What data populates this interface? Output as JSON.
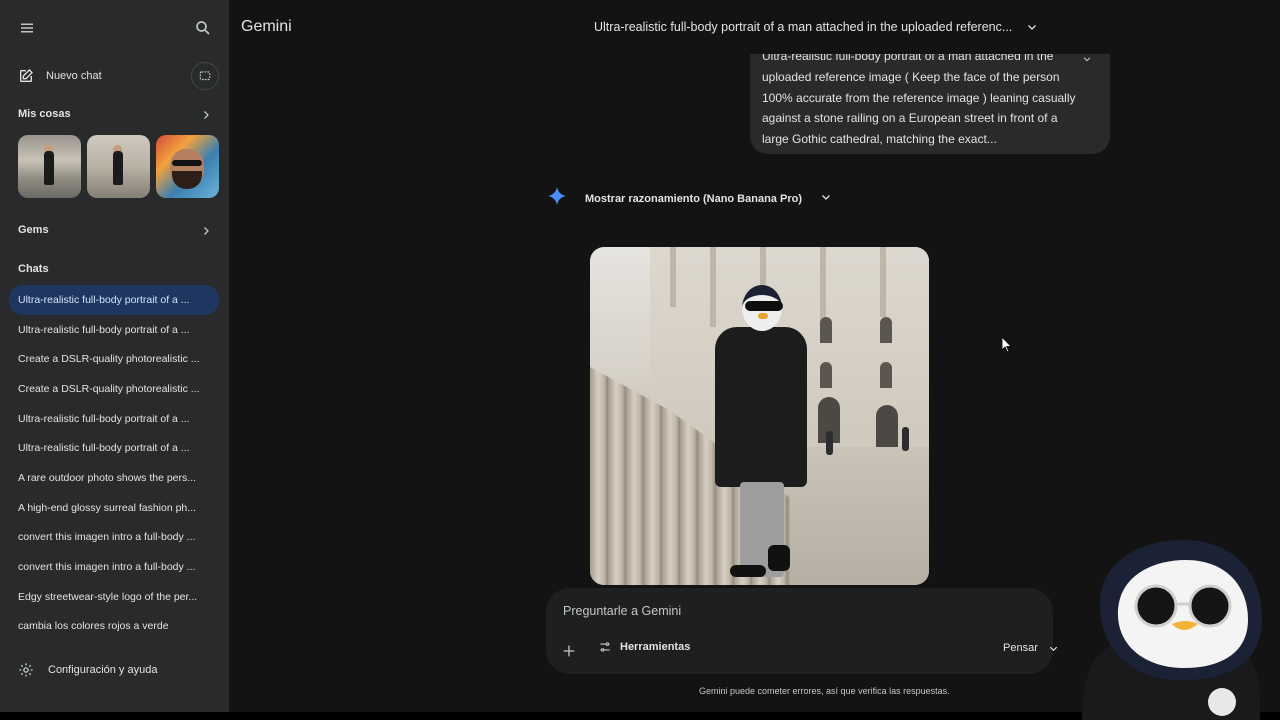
{
  "sidebar": {
    "menu_icon": "menu-icon",
    "search_icon": "search-icon",
    "new_chat_label": "Nuevo chat",
    "my_stuff_label": "Mis cosas",
    "gems_label": "Gems",
    "chats_label": "Chats",
    "chats": [
      {
        "label": "Ultra-realistic full-body portrait of a ...",
        "active": true
      },
      {
        "label": "Ultra-realistic full-body portrait of a ...",
        "active": false
      },
      {
        "label": "Create a DSLR-quality photorealistic ...",
        "active": false
      },
      {
        "label": "Create a DSLR-quality photorealistic ...",
        "active": false
      },
      {
        "label": "Ultra-realistic full-body portrait of a ...",
        "active": false
      },
      {
        "label": "Ultra-realistic full-body portrait of a ...",
        "active": false
      },
      {
        "label": "A rare outdoor photo shows the pers...",
        "active": false
      },
      {
        "label": "A high-end glossy surreal fashion ph...",
        "active": false
      },
      {
        "label": "convert this imagen intro a full-body ...",
        "active": false
      },
      {
        "label": "convert this imagen intro a full-body ...",
        "active": false
      },
      {
        "label": "Edgy streetwear-style logo of the per...",
        "active": false
      },
      {
        "label": "cambia los colores rojos a verde",
        "active": false
      }
    ],
    "settings_label": "Configuración y ayuda"
  },
  "header": {
    "brand": "Gemini",
    "conversation_title": "Ultra-realistic full-body portrait of a man attached in the uploaded referenc..."
  },
  "conversation": {
    "user_message": "Ultra-realistic full-body portrait of a man attached in the uploaded reference image ( Keep the face of the person 100% accurate from the reference image ) leaning casually against a stone railing on a European street in front of a large Gothic cathedral, matching the exact...",
    "reasoning_label": "Mostrar razonamiento (Nano Banana Pro)"
  },
  "composer": {
    "placeholder": "Preguntarle a Gemini",
    "tools_label": "Herramientas",
    "mode_label": "Pensar"
  },
  "footer": {
    "disclaimer": "Gemini puede cometer errores, así que verifica las respuestas."
  },
  "colors": {
    "sidebar_bg": "#282a2c",
    "main_bg": "#131314",
    "active_chat_bg": "#1f3760",
    "gemini_spark": "#4b8cf5"
  }
}
